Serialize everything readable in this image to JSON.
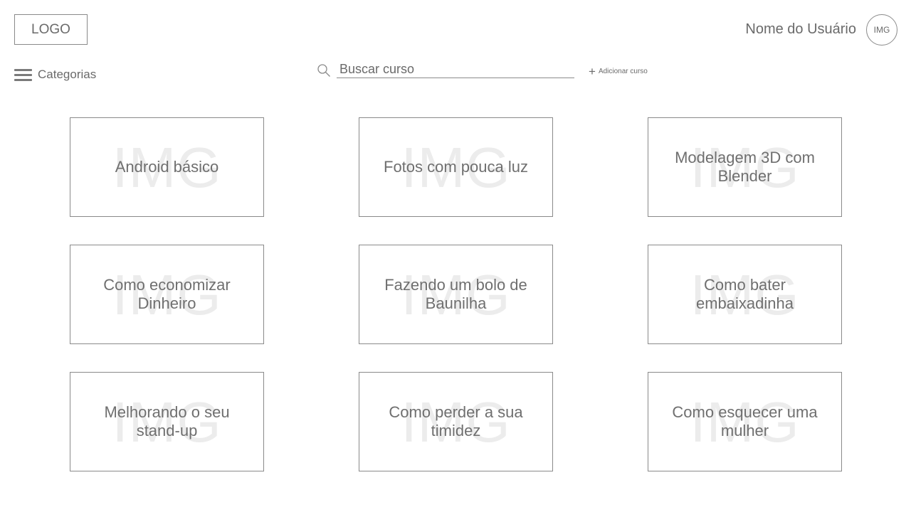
{
  "header": {
    "logo": "LOGO",
    "user_name": "Nome do Usuário",
    "avatar": "IMG"
  },
  "toolbar": {
    "categories_label": "Categorias",
    "search_placeholder": "Buscar curso",
    "add_course_label": "Adicionar curso",
    "icons": {
      "menu": "hamburger-icon",
      "search": "search-icon",
      "add": "plus-icon"
    }
  },
  "courses": [
    {
      "title": "Android básico",
      "image": "IMG"
    },
    {
      "title": "Fotos com pouca luz",
      "image": "IMG"
    },
    {
      "title": "Modelagem 3D com Blender",
      "image": "IMG"
    },
    {
      "title": "Como economizar Dinheiro",
      "image": "IMG"
    },
    {
      "title": "Fazendo um bolo de Baunilha",
      "image": "IMG"
    },
    {
      "title": "Como bater embaixadinha",
      "image": "IMG"
    },
    {
      "title": "Melhorando o seu stand-up",
      "image": "IMG"
    },
    {
      "title": "Como perder a sua timidez",
      "image": "IMG"
    },
    {
      "title": "Como esquecer uma mulher",
      "image": "IMG"
    }
  ]
}
